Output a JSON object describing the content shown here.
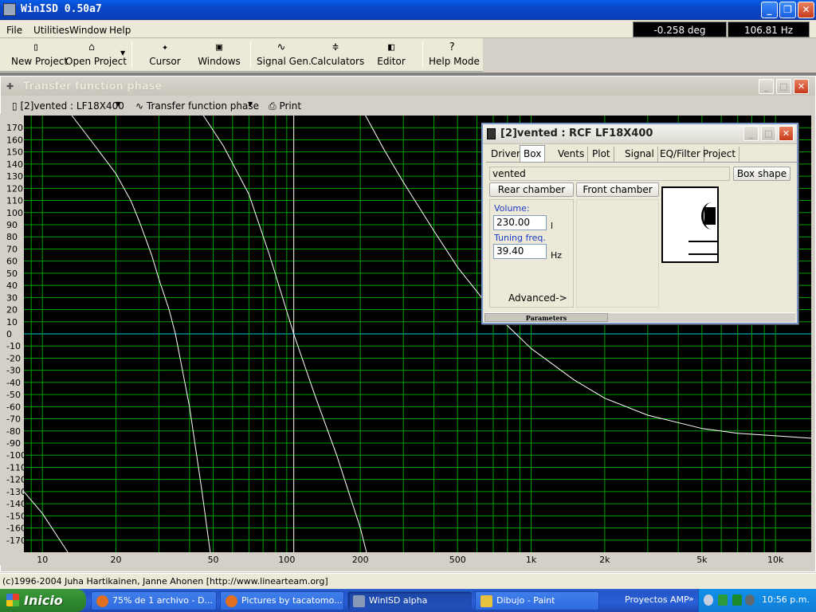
{
  "app": {
    "title": "WinISD 0.50a7"
  },
  "menu": [
    "File",
    "Utilities",
    "Window",
    "Help"
  ],
  "toolbar": {
    "buttons": [
      {
        "label": "New Project",
        "icon": "new-project-icon"
      },
      {
        "label": "Open Project",
        "icon": "open-project-icon"
      },
      {
        "label": "Cursor",
        "icon": "cursor-icon"
      },
      {
        "label": "Windows",
        "icon": "windows-icon"
      },
      {
        "label": "Signal Gen.",
        "icon": "signal-generator-icon"
      },
      {
        "label": "Calculators",
        "icon": "calculator-icon"
      },
      {
        "label": "Editor",
        "icon": "editor-icon"
      },
      {
        "label": "Help Mode",
        "icon": "help-mode-icon"
      }
    ]
  },
  "phase_window": {
    "title": "Transfer function phase",
    "project_select": "[2]vented : LF18X400",
    "graph_select": "Transfer function phase",
    "print_label": "Print",
    "readout_phase": "-0.258 deg",
    "readout_freq": "106.81 Hz"
  },
  "box_window": {
    "title": "[2]vented : RCF LF18X400",
    "tabs": [
      "Driver",
      "Box",
      "Vents",
      "Plot",
      "Signal",
      "EQ/Filter",
      "Project"
    ],
    "active_tab": "Box",
    "box_type": "vented",
    "box_shape_button": "Box shape",
    "rear_chamber_button": "Rear chamber",
    "front_chamber_button": "Front chamber",
    "volume_label": "Volume:",
    "volume_value": "230.00",
    "volume_unit": "l",
    "tuning_label": "Tuning freq.",
    "tuning_value": "39.40",
    "tuning_unit": "Hz",
    "advanced_label": "Advanced->",
    "status_panel": "Parameters"
  },
  "status_line": "(c)1996-2004 Juha Hartikainen, Janne Ahonen [http://www.linearteam.org]",
  "taskbar": {
    "start_label": "Inicio",
    "tasks": [
      {
        "label": "75% de 1 archivo - D...",
        "color": "#e07020"
      },
      {
        "label": "Pictures by tacatomo...",
        "color": "#e07020"
      },
      {
        "label": "WinISD alpha",
        "color": "#8898b8"
      },
      {
        "label": "Dibujo - Paint",
        "color": "#e8c040"
      }
    ],
    "toolbar_label": "Proyectos AMP",
    "clock": "10:56 p.m."
  },
  "chart_data": {
    "type": "line",
    "title": "",
    "xlabel": "",
    "ylabel": "",
    "x_scale": "log",
    "xlim": [
      8.4,
      14000
    ],
    "ylim": [
      -180,
      180
    ],
    "grid": true,
    "background": "#000000",
    "grid_color": "#00a000",
    "curve_color": "#ffffff",
    "cursor_x": 106.81,
    "x_tick_labels": [
      "10",
      "20",
      "50",
      "100",
      "200",
      "500",
      "1k",
      "2k",
      "5k",
      "10k"
    ],
    "x_tick_values": [
      10,
      20,
      50,
      100,
      200,
      500,
      1000,
      2000,
      5000,
      10000
    ],
    "y_tick_labels": [
      "170",
      "160",
      "150",
      "140",
      "130",
      "120",
      "110",
      "100",
      "90",
      "80",
      "70",
      "60",
      "50",
      "40",
      "30",
      "20",
      "10",
      "0",
      "-10",
      "-20",
      "-30",
      "-40",
      "-50",
      "-60",
      "-70",
      "-80",
      "-90",
      "-100",
      "-110",
      "-120",
      "-130",
      "-140",
      "-150",
      "-160",
      "-170"
    ],
    "series": [
      {
        "name": "",
        "x": [
          8.4,
          10,
          12.7
        ],
        "y": [
          -130,
          -148,
          -180
        ]
      },
      {
        "name": "",
        "x": [
          13.2,
          16,
          20,
          23,
          25,
          28,
          30,
          33,
          35,
          40,
          45,
          48.6
        ],
        "y": [
          180,
          158,
          132,
          110,
          92,
          65,
          45,
          20,
          0,
          -60,
          -130,
          -180
        ]
      },
      {
        "name": "",
        "x": [
          45.6,
          55,
          70,
          85,
          106.8,
          130,
          160,
          200,
          212
        ],
        "y": [
          180,
          155,
          115,
          65,
          0,
          -50,
          -100,
          -160,
          -180
        ]
      },
      {
        "name": "",
        "x": [
          210,
          250,
          300,
          400,
          500,
          700,
          1000,
          1500,
          2000,
          3000,
          5000,
          7000,
          10000,
          14000
        ],
        "y": [
          180,
          152,
          125,
          85,
          55,
          18,
          -12,
          -38,
          -53,
          -67,
          -78,
          -82,
          -84,
          -86
        ]
      }
    ]
  }
}
